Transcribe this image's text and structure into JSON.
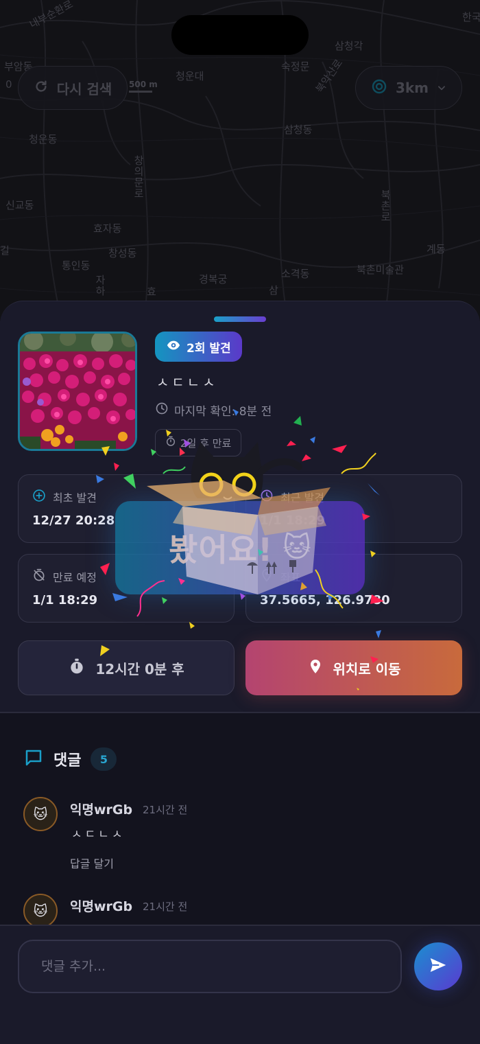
{
  "map": {
    "labels": [
      {
        "text": "내부순환로"
      },
      {
        "text": "한국"
      },
      {
        "text": "삼청각"
      },
      {
        "text": "부암동"
      },
      {
        "text": "청운대"
      },
      {
        "text": "숙정문"
      },
      {
        "text": "북악산로"
      },
      {
        "text": "0"
      },
      {
        "text": "삼청동"
      },
      {
        "text": "청운동"
      },
      {
        "text": "창의문로"
      },
      {
        "text": "신교동"
      },
      {
        "text": "북촌로"
      },
      {
        "text": "효자동"
      },
      {
        "text": "계동"
      },
      {
        "text": "창성동"
      },
      {
        "text": "통인동"
      },
      {
        "text": "소격동"
      },
      {
        "text": "북촌미술관"
      },
      {
        "text": "경복궁"
      },
      {
        "text": "자하"
      },
      {
        "text": "효"
      },
      {
        "text": "삼"
      },
      {
        "text": "길"
      }
    ],
    "research_label": "다시 검색",
    "scale_label": "500 m",
    "radius_label": "3km"
  },
  "post": {
    "seen_badge": "2회 발견",
    "title": "ㅅㄷㄴㅅ",
    "last_seen": "마지막 확인: 8분 전",
    "expire_chip": "2일 후 만료",
    "cards": {
      "first": {
        "label": "최초 발견",
        "value": "12/27 20:28"
      },
      "last": {
        "label": "최근 발견",
        "value": "1/1 18:29"
      },
      "expire": {
        "label": "만료 예정",
        "value": "1/1 18:29"
      },
      "coord": {
        "label": "좌표",
        "value": "37.5665, 126.9780"
      }
    },
    "timer_label": "12시간 0분 후",
    "goto_label": "위치로 이동"
  },
  "comments": {
    "title": "댓글",
    "count": "5",
    "items": [
      {
        "name": "익명wrGb",
        "time": "21시간 전",
        "text": "ㅅㄷㄴㅅ",
        "reply": "답글 달기",
        "avatar": "🐱"
      },
      {
        "name": "익명wrGb",
        "time": "21시간 전",
        "avatar": "🐱"
      }
    ],
    "input_placeholder": "댓글 추가..."
  },
  "celebration": {
    "text": "봤어요!",
    "emoji": "🐱"
  },
  "colors": {
    "accent_cyan": "#1a9fc8",
    "accent_purple": "#5b39c9",
    "goto_gradient_start": "#b44470",
    "goto_gradient_end": "#c86a3c"
  }
}
